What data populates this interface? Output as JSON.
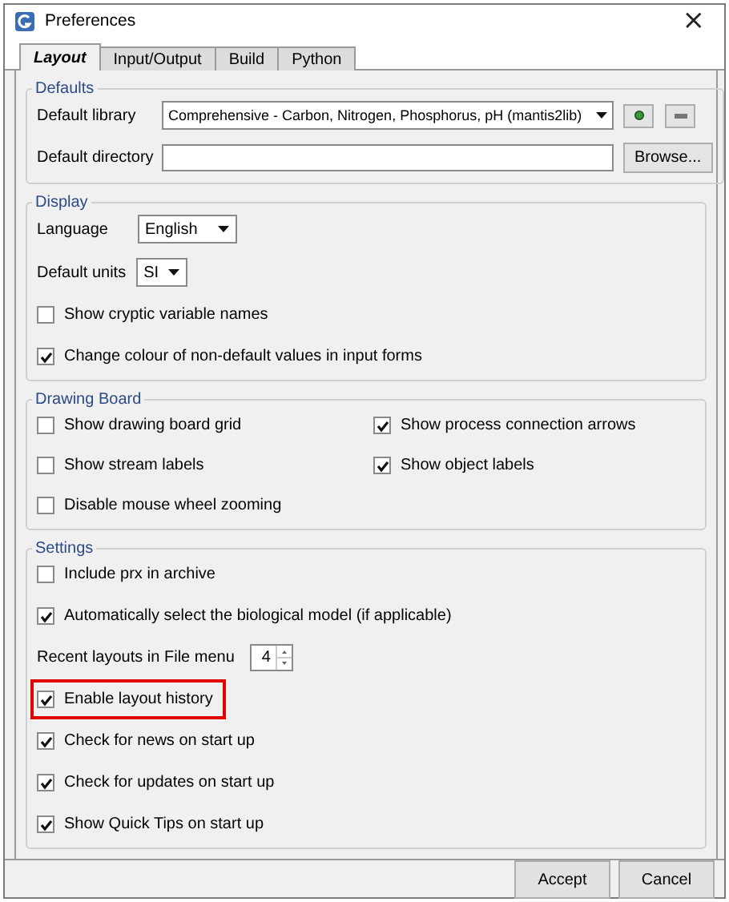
{
  "window": {
    "title": "Preferences",
    "close": "×"
  },
  "tabs": [
    {
      "label": "Layout",
      "selected": true
    },
    {
      "label": "Input/Output",
      "selected": false
    },
    {
      "label": "Build",
      "selected": false
    },
    {
      "label": "Python",
      "selected": false
    }
  ],
  "sections": [
    {
      "title": "Defaults",
      "kind": "list",
      "items": [
        {
          "kind": "library",
          "label": "Default library",
          "value": "Comprehensive - Carbon, Nitrogen, Phosphorus, pH (mantis2lib)"
        },
        {
          "kind": "directory",
          "label": "Default directory",
          "value": "",
          "button": "Browse..."
        }
      ]
    },
    {
      "title": "Display",
      "kind": "list",
      "items": [
        {
          "kind": "select",
          "label": "Language",
          "value": "English"
        },
        {
          "kind": "select",
          "label": "Default units",
          "value": "SI"
        },
        {
          "kind": "checkbox",
          "label": "Show cryptic variable names",
          "checked": false
        },
        {
          "kind": "checkbox",
          "label": "Change colour of non-default values in input forms",
          "checked": true
        }
      ]
    },
    {
      "title": "Drawing Board",
      "kind": "grid",
      "items": [
        {
          "kind": "checkbox",
          "label": "Show drawing board grid",
          "checked": false
        },
        {
          "kind": "checkbox",
          "label": "Show process connection arrows",
          "checked": true
        },
        {
          "kind": "checkbox",
          "label": "Show stream labels",
          "checked": false
        },
        {
          "kind": "checkbox",
          "label": "Show object labels",
          "checked": true
        },
        {
          "kind": "checkbox",
          "label": "Disable mouse wheel zooming",
          "checked": false
        }
      ]
    },
    {
      "title": "Settings",
      "kind": "list",
      "items": [
        {
          "kind": "checkbox",
          "label": "Include prx in archive",
          "checked": false
        },
        {
          "kind": "checkbox",
          "label": "Automatically select the biological model (if applicable)",
          "checked": true
        },
        {
          "kind": "spinner",
          "label": "Recent layouts in File menu",
          "value": "4"
        },
        {
          "kind": "checkbox",
          "label": "Enable layout history",
          "checked": true,
          "highlighted": true
        },
        {
          "kind": "checkbox",
          "label": "Check for news on start up",
          "checked": true
        },
        {
          "kind": "checkbox",
          "label": "Check for updates on start up",
          "checked": true
        },
        {
          "kind": "checkbox",
          "label": "Show Quick Tips on start up",
          "checked": true
        }
      ]
    }
  ],
  "buttons": [
    "Accept",
    "Cancel"
  ]
}
